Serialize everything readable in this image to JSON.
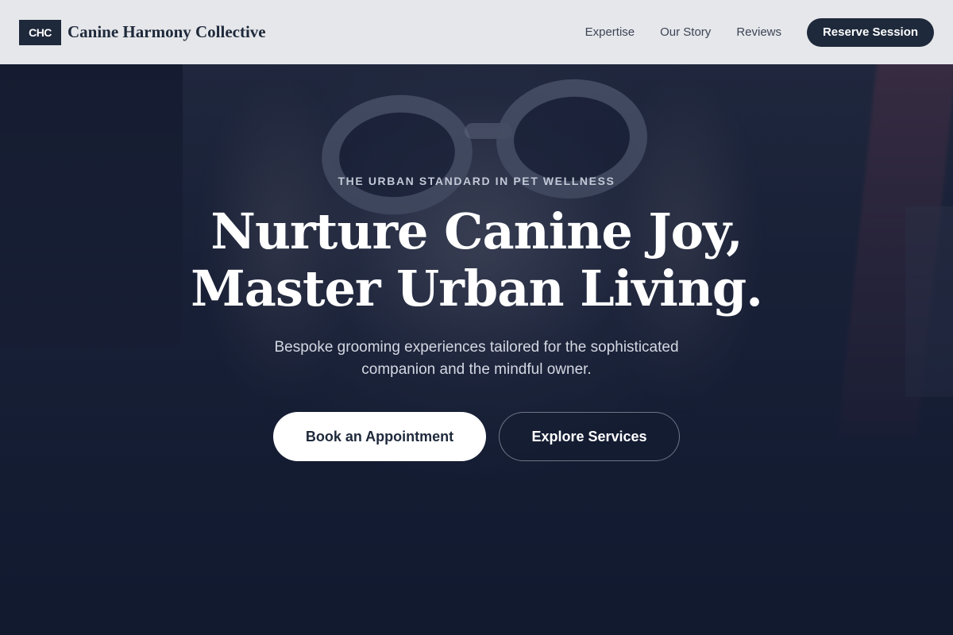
{
  "brand": {
    "badge": "CHC",
    "name": "Canine Harmony Collective"
  },
  "nav": {
    "items": [
      {
        "label": "Expertise"
      },
      {
        "label": "Our Story"
      },
      {
        "label": "Reviews"
      }
    ],
    "cta_label": "Reserve Session"
  },
  "hero": {
    "eyebrow": "THE URBAN STANDARD IN PET WELLNESS",
    "headline_line1": "Nurture Canine Joy,",
    "headline_line2": "Master Urban Living.",
    "subtext_line1": "Bespoke grooming experiences tailored for the sophisticated",
    "subtext_line2": "companion and the mindful owner.",
    "primary_cta": "Book an Appointment",
    "secondary_cta": "Explore Services"
  },
  "colors": {
    "brand_dark": "#1e293b",
    "header_bg": "#ecedef",
    "hero_overlay": "#141d33",
    "white": "#ffffff"
  }
}
